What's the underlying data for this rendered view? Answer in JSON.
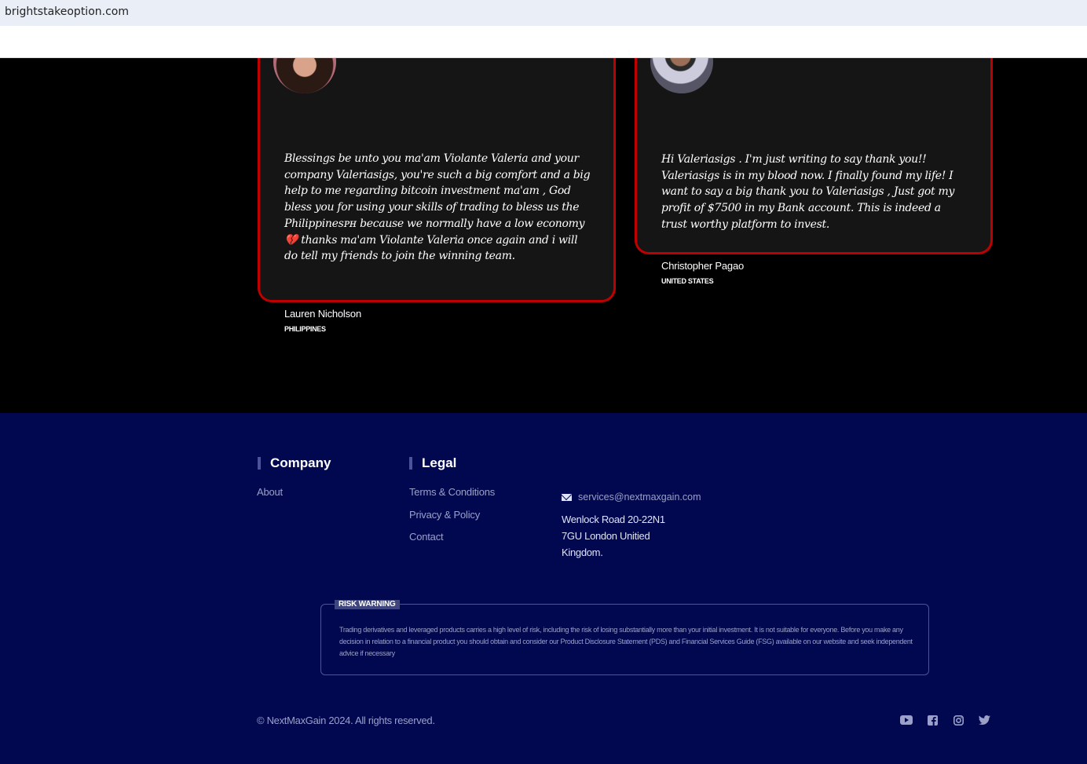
{
  "browser": {
    "url": "brightstakeoption.com"
  },
  "testimonials": [
    {
      "quote": "Blessings be unto you ma'am Violante Valeria and your company Valeriasigs, you're such a big comfort and a big help to me regarding bitcoin investment ma'am , God bless you for using your skills of trading to bless us the Philippinesᴘʜ because we normally have a low economy 💔 thanks ma'am Violante Valeria once again and i will do tell my friends to join the winning team.",
      "name": "Lauren Nicholson",
      "country": "PHILIPPINES"
    },
    {
      "quote": "Hi Valeriasigs . I'm just writing to say thank you!! Valeriasigs is in my blood now. I finally found my life! I want to say a big thank you to Valeriasigs , Just got my profit of $7500 in my Bank account. This is indeed a trust worthy platform to invest.",
      "name": "Christopher Pagao",
      "country": "UNITED STATES"
    }
  ],
  "footer": {
    "company": {
      "title": "Company",
      "links": [
        "About"
      ]
    },
    "legal": {
      "title": "Legal",
      "links": [
        "Terms & Conditions",
        "Privacy & Policy",
        "Contact"
      ]
    },
    "contact": {
      "email": "services@nextmaxgain.com",
      "address_lines": [
        "Wenlock Road 20-22N1",
        "7GU London Unitied",
        "Kingdom."
      ]
    },
    "risk": {
      "label": "RISK WARNING",
      "text": "Trading derivatives and leveraged products carries a high level of risk, including the risk of losing substantially more than your initial investment. It is not suitable for everyone. Before you make any decision in relation to a financial product you should obtain and consider our Product Disclosure Statement (PDS) and Financial Services Guide (FSG) available on our website and seek independent advice if necessary"
    },
    "copyright": "© NextMaxGain 2024. All rights reserved.",
    "socials": [
      "youtube-icon",
      "facebook-icon",
      "instagram-icon",
      "twitter-icon"
    ]
  },
  "colors": {
    "footer_bg": "#010850",
    "card_border": "#c00000",
    "card_bg": "#151515"
  }
}
